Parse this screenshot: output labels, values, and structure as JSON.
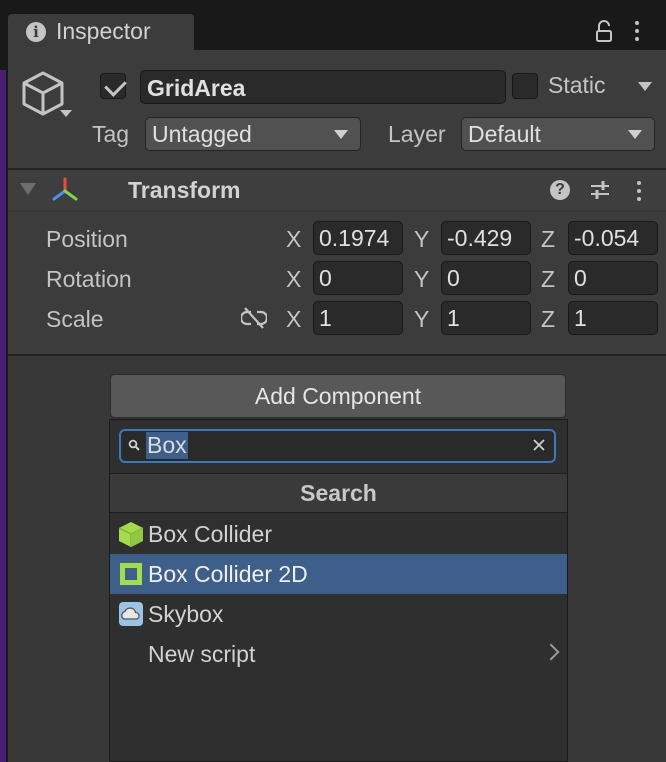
{
  "inspector": {
    "tab_title": "Inspector"
  },
  "gameobject": {
    "active": true,
    "name": "GridArea",
    "static_label": "Static",
    "static_checked": false,
    "tag_label": "Tag",
    "tag_value": "Untagged",
    "layer_label": "Layer",
    "layer_value": "Default"
  },
  "transform": {
    "title": "Transform",
    "rows": [
      {
        "label": "Position",
        "x": "0.1974",
        "y": "-0.429",
        "z": "-0.054"
      },
      {
        "label": "Rotation",
        "x": "0",
        "y": "0",
        "z": "0"
      },
      {
        "label": "Scale",
        "x": "1",
        "y": "1",
        "z": "1"
      }
    ],
    "axes": {
      "x": "X",
      "y": "Y",
      "z": "Z"
    }
  },
  "add_component": {
    "button_label": "Add Component",
    "search_value": "Box",
    "section_title": "Search",
    "items": [
      {
        "label": "Box Collider",
        "icon": "box-collider-icon",
        "selected": false
      },
      {
        "label": "Box Collider 2D",
        "icon": "box-collider-2d-icon",
        "selected": true
      },
      {
        "label": "Skybox",
        "icon": "skybox-icon",
        "selected": false
      },
      {
        "label": "New script",
        "icon": "chevron-right-icon",
        "selected": false
      }
    ]
  },
  "colors": {
    "accent": "#3a79bb",
    "selection": "#3e5f8a",
    "collider_green": "#a3dc4f",
    "transform_red": "#e84b3a",
    "transform_green": "#7bd64b",
    "transform_blue": "#4a8ff0"
  }
}
